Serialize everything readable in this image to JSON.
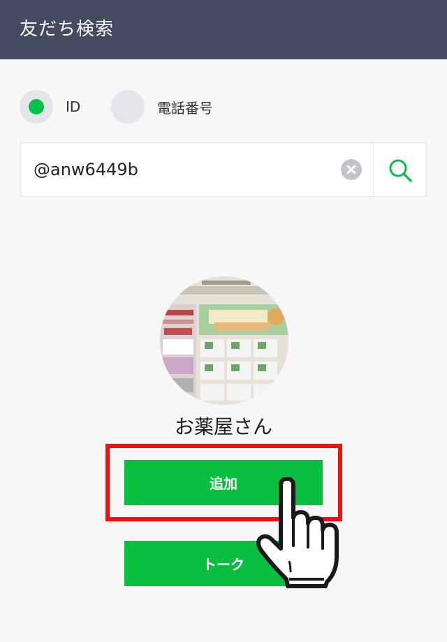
{
  "header": {
    "title": "友だち検索"
  },
  "search_type": {
    "options": [
      {
        "label": "ID",
        "selected": true
      },
      {
        "label": "電話番号",
        "selected": false
      }
    ]
  },
  "search": {
    "value": "@anw6449b"
  },
  "result": {
    "name": "お薬屋さん"
  },
  "actions": {
    "add_label": "追加",
    "talk_label": "トーク"
  },
  "colors": {
    "accent": "#08c14a",
    "header_bg": "#444b61",
    "highlight": "#ee1111"
  }
}
